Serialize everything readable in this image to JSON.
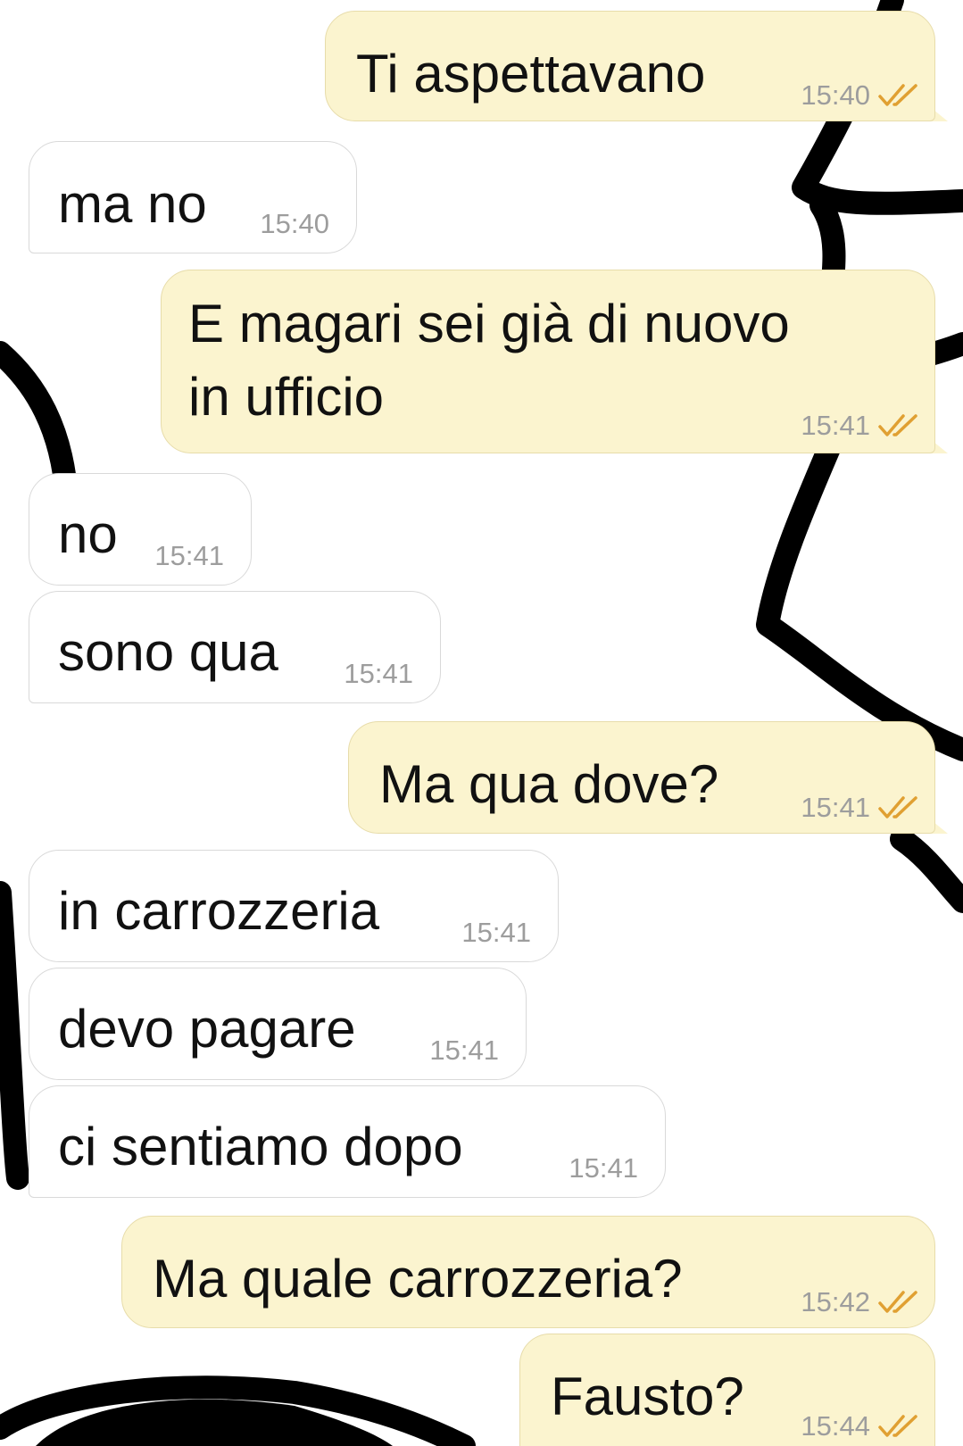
{
  "theme": {
    "incoming_bg": "#ffffff",
    "outgoing_bg": "#fbf4cf",
    "time_color": "#9d9d9d",
    "read_tick_color": "#e0a032"
  },
  "messages": [
    {
      "direction": "outgoing",
      "text": "Ti aspettavano",
      "time": "15:40",
      "status": "read-double-tick-icon"
    },
    {
      "direction": "incoming",
      "text": "ma no",
      "time": "15:40"
    },
    {
      "direction": "outgoing",
      "text_lines": [
        "E magari sei già di nuovo",
        "in ufficio"
      ],
      "time": "15:41",
      "status": "read-double-tick-icon"
    },
    {
      "direction": "incoming",
      "text": "no",
      "time": "15:41"
    },
    {
      "direction": "incoming",
      "text": "sono qua",
      "time": "15:41"
    },
    {
      "direction": "outgoing",
      "text": "Ma qua dove?",
      "time": "15:41",
      "status": "read-double-tick-icon"
    },
    {
      "direction": "incoming",
      "text": "in carrozzeria",
      "time": "15:41"
    },
    {
      "direction": "incoming",
      "text": "devo pagare",
      "time": "15:41"
    },
    {
      "direction": "incoming",
      "text": "ci sentiamo dopo",
      "time": "15:41"
    },
    {
      "direction": "outgoing",
      "text": "Ma quale carrozzeria?",
      "time": "15:42",
      "status": "read-double-tick-icon"
    },
    {
      "direction": "outgoing",
      "text": "Fausto?",
      "time": "15:44",
      "status": "read-double-tick-icon"
    }
  ]
}
